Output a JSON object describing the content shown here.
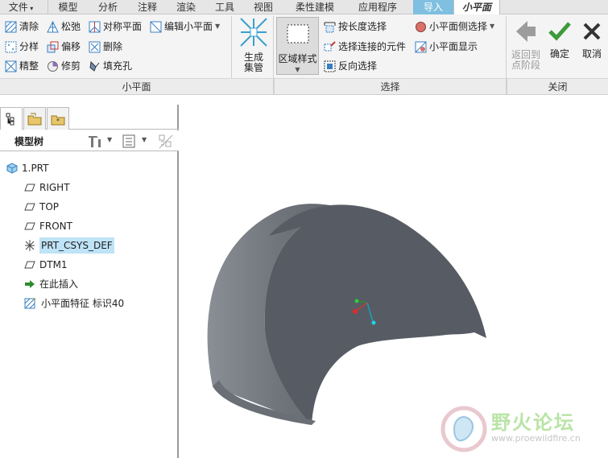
{
  "menubar": {
    "file": "文件",
    "items": [
      "模型",
      "分析",
      "注释",
      "渲染",
      "工具",
      "视图",
      "柔性建模",
      "应用程序"
    ],
    "import_tab": "导入",
    "current_tab": "小平面"
  },
  "ribbon": {
    "col1": [
      "清除",
      "分样",
      "精整"
    ],
    "col2": [
      "松弛",
      "偏移",
      "修剪"
    ],
    "col3": [
      "对称平面",
      "删除",
      "填充孔"
    ],
    "edit_facet": "编辑小平面",
    "generate_btn": "生成\n集管",
    "region_style": "区域样式",
    "select_items": [
      "按长度选择",
      "选择连接的元件",
      "反向选择"
    ],
    "facet_select": "小平面侧选择",
    "facet_display": "小平面显示",
    "back_btn": "返回到\n点阶段",
    "ok_btn": "确定",
    "cancel_btn": "取消",
    "groups": [
      "小平面",
      "选择",
      "关闭"
    ]
  },
  "model_tree": {
    "header": "模型树",
    "nodes": [
      "1.PRT",
      "RIGHT",
      "TOP",
      "FRONT",
      "PRT_CSYS_DEF",
      "DTM1",
      "在此插入",
      "小平面特征 标识40"
    ]
  },
  "watermark": {
    "title": "野火论坛",
    "url": "www.proewildfire.cn"
  },
  "colors": {
    "accent": "#7fbfe0",
    "selection": "#bfe3f7",
    "model_face": "#565b63",
    "model_side": "#7a7f86"
  }
}
